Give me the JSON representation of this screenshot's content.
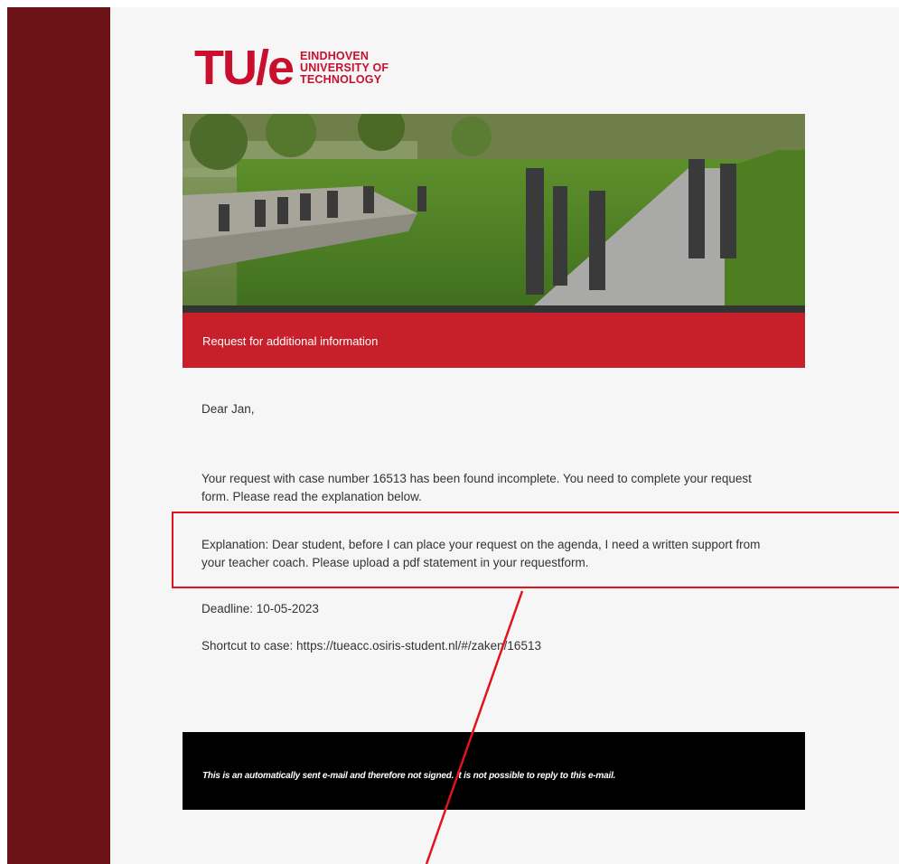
{
  "logo": {
    "mark": "TU/e",
    "line1": "EINDHOVEN",
    "line2": "UNIVERSITY OF",
    "line3": "TECHNOLOGY"
  },
  "hero": {
    "icon": "campus-photo"
  },
  "banner": {
    "title": "Request for additional information"
  },
  "email": {
    "greeting": "Dear Jan,",
    "intro": "Your request with case number 16513 has been found incomplete. You need to complete your request form. Please read the explanation below.",
    "explanation": "Explanation: Dear student, before I can place your request on the agenda, I need a written support from your teacher coach. Please upload a pdf statement in your requestform.",
    "deadline": "Deadline: 10-05-2023",
    "shortcut": "Shortcut to case: https://tueacc.osiris-student.nl/#/zaken/16513"
  },
  "footer": {
    "note": "This is an automatically sent e-mail and therefore not signed. It is not possible to reply to this e-mail."
  },
  "colors": {
    "brand_red": "#c8202a",
    "sidebar": "#6b1216",
    "annotation_red": "#e0141c"
  }
}
